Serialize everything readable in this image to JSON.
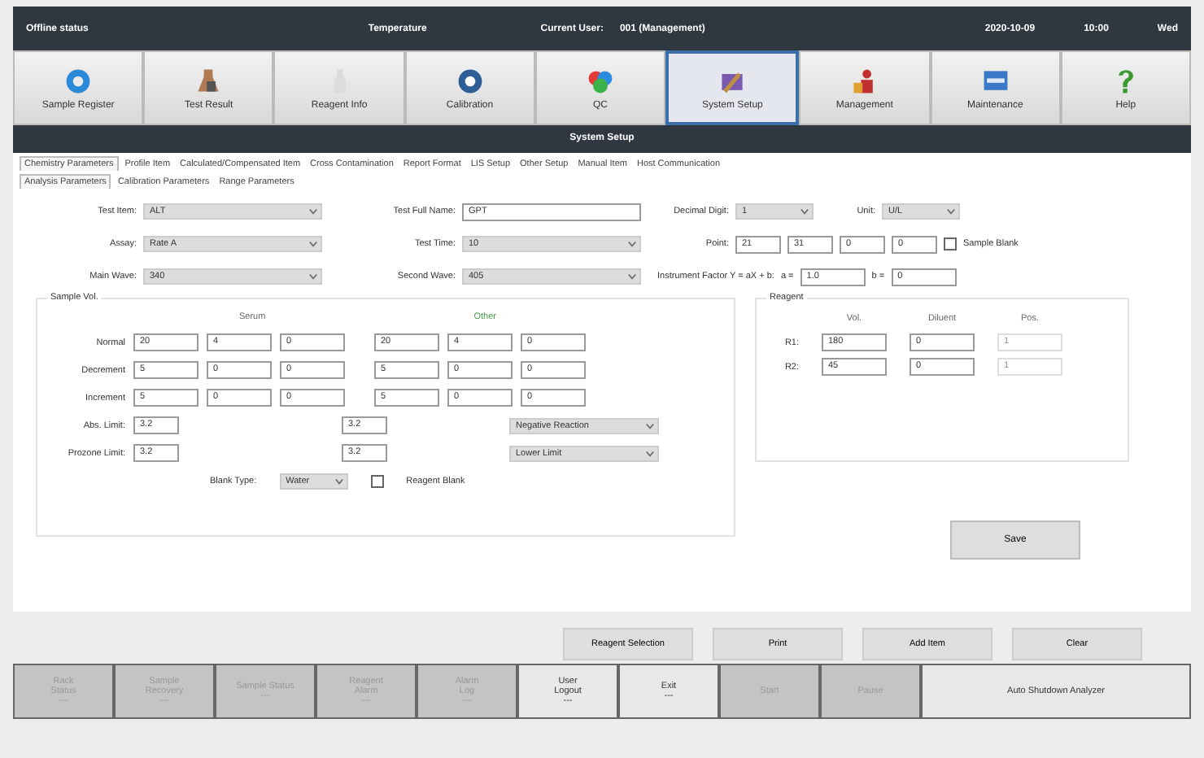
{
  "top_bar": [
    {
      "text": "Offline status"
    },
    {
      "text": "Temperature"
    },
    {
      "text": "Current User:"
    },
    {
      "text": "001 (Management)"
    },
    {
      "text": "2020-10-09"
    },
    {
      "text": "10:00"
    },
    {
      "text": "Wed"
    }
  ],
  "toolbar": [
    {
      "label": "Sample Register",
      "selected": false
    },
    {
      "label": "Test Result",
      "selected": false
    },
    {
      "label": "Reagent Info",
      "selected": false
    },
    {
      "label": "Calibration",
      "selected": false
    },
    {
      "label": "QC",
      "selected": false
    },
    {
      "label": "System Setup",
      "selected": true
    },
    {
      "label": "Management",
      "selected": false
    },
    {
      "label": "Maintenance",
      "selected": false
    },
    {
      "label": "Help",
      "selected": false
    }
  ],
  "title": "System Setup",
  "tabs": [
    {
      "label": "Chemistry Parameters",
      "selected": true
    },
    {
      "label": "Profile Item",
      "selected": false
    },
    {
      "label": "Calculated/Compensated Item",
      "selected": false
    },
    {
      "label": "Cross Contamination",
      "selected": false
    },
    {
      "label": "Report Format",
      "selected": false
    },
    {
      "label": "LIS Setup",
      "selected": false
    },
    {
      "label": "Other Setup",
      "selected": false
    },
    {
      "label": "Manual Item",
      "selected": false
    },
    {
      "label": "Host Communication",
      "selected": false
    }
  ],
  "subtabs": [
    {
      "label": "Analysis Parameters",
      "selected": true
    },
    {
      "label": "Calibration Parameters",
      "selected": false
    },
    {
      "label": "Range Parameters",
      "selected": false
    }
  ],
  "form": {
    "test_item": {
      "label": "Test Item:",
      "value": "ALT"
    },
    "assay": {
      "label": "Assay:",
      "value": "Rate A"
    },
    "main_wave": {
      "label": "Main Wave:",
      "value": "340"
    },
    "full_name": {
      "label": "Test Full Name:",
      "value": "GPT"
    },
    "test_time": {
      "label": "Test Time:",
      "value": "10"
    },
    "second_wave": {
      "label": "Second Wave:",
      "value": "405"
    },
    "decimal": {
      "label": "Decimal Digit:",
      "value": "1"
    },
    "unit": {
      "label": "Unit:",
      "value": "U/L"
    },
    "point": {
      "label": "Point:",
      "values": [
        "21",
        "31",
        "0",
        "0"
      ]
    },
    "sample_blank": {
      "label": "Sample Blank",
      "checked": false
    },
    "factor": {
      "label": "Instrument Factor Y = aX + b:",
      "a_label": "a =",
      "a": "1.0",
      "b_label": "b =",
      "b": "0"
    }
  },
  "sample_vol": {
    "title": "Sample Vol.",
    "serum": "Serum",
    "other": "Other",
    "rows": [
      {
        "label": "Normal",
        "serum": [
          "20",
          "4",
          "0"
        ],
        "other": [
          "20",
          "4",
          "0"
        ]
      },
      {
        "label": "Decrement",
        "serum": [
          "5",
          "0",
          "0"
        ],
        "other": [
          "5",
          "0",
          "0"
        ]
      },
      {
        "label": "Increment",
        "serum": [
          "5",
          "0",
          "0"
        ],
        "other": [
          "5",
          "0",
          "0"
        ]
      }
    ],
    "abs_limit": {
      "label": "Abs. Limit:",
      "serum": "3.2",
      "other": "3.2",
      "select": "Negative Reaction"
    },
    "prozone": {
      "label": "Prozone Limit:",
      "serum": "3.2",
      "other": "3.2",
      "select": "Lower Limit"
    },
    "blank_type": {
      "label": "Blank Type:",
      "value": "Water"
    },
    "reagent_blank": {
      "label": "Reagent Blank",
      "checked": false
    }
  },
  "reagent": {
    "title": "Reagent",
    "columns": [
      "Vol.",
      "Diluent",
      "Pos."
    ],
    "rows": [
      {
        "label": "R1:",
        "values": [
          "180",
          "0",
          "1"
        ]
      },
      {
        "label": "R2:",
        "values": [
          "45",
          "0",
          "1"
        ]
      }
    ]
  },
  "save": "Save",
  "actions": [
    "Reagent Selection",
    "Print",
    "Add Item",
    "Clear"
  ],
  "status_bar": [
    {
      "lines": [
        "Rack",
        "Status",
        "---"
      ],
      "disabled": true
    },
    {
      "lines": [
        "Sample",
        "Recovery",
        "---"
      ],
      "disabled": true
    },
    {
      "lines": [
        "Sample Status",
        "---"
      ],
      "disabled": true
    },
    {
      "lines": [
        "Reagent",
        "Alarm",
        "---"
      ],
      "disabled": true
    },
    {
      "lines": [
        "Alarm",
        "Log",
        "---"
      ],
      "disabled": true
    },
    {
      "lines": [
        "User",
        "Logout",
        "---"
      ],
      "disabled": false
    },
    {
      "lines": [
        "Exit",
        "---"
      ],
      "disabled": false
    },
    {
      "lines": [
        "Start"
      ],
      "disabled": true
    },
    {
      "lines": [
        "Pause"
      ],
      "disabled": true
    },
    {
      "lines": [
        "Auto Shutdown Analyzer"
      ],
      "disabled": false
    }
  ]
}
